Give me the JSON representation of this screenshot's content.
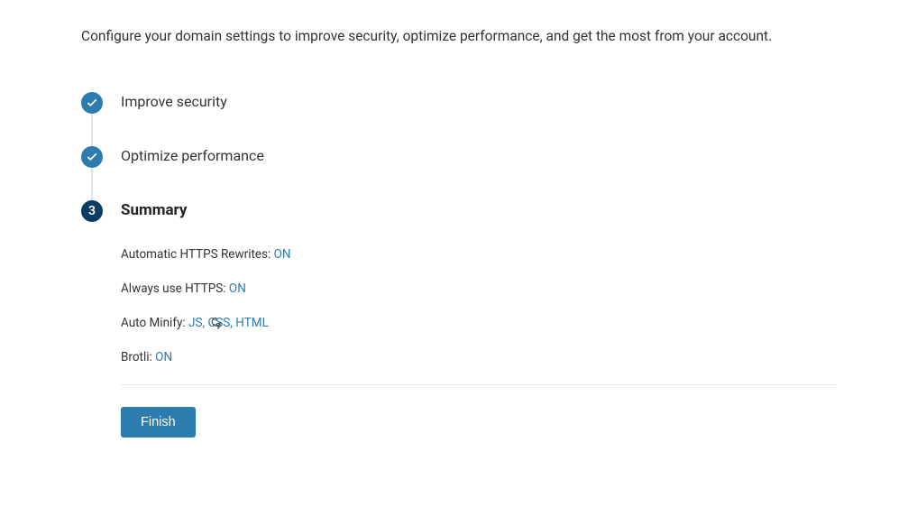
{
  "intro": "Configure your domain settings to improve security, optimize performance, and get the most from your account.",
  "steps": {
    "s1": {
      "label": "Improve security"
    },
    "s2": {
      "label": "Optimize performance"
    },
    "s3": {
      "number": "3",
      "label": "Summary"
    }
  },
  "summary": {
    "https_rewrites": {
      "label": "Automatic HTTPS Rewrites: ",
      "value": "ON"
    },
    "always_https": {
      "label": "Always use HTTPS: ",
      "value": "ON"
    },
    "auto_minify": {
      "label": "Auto Minify: ",
      "value": "JS, CSS, HTML"
    },
    "brotli": {
      "label": "Brotli: ",
      "value": "ON"
    }
  },
  "actions": {
    "finish": "Finish"
  }
}
